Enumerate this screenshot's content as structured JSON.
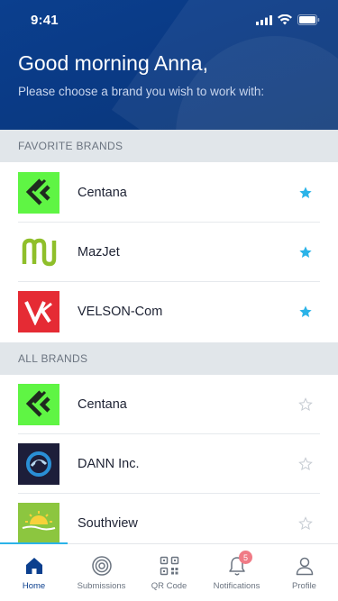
{
  "status_bar": {
    "time": "9:41"
  },
  "header": {
    "greeting": "Good morning Anna,",
    "subtitle": "Please choose a brand you wish to work with:"
  },
  "sections": {
    "favorites_title": "FAVORITE BRANDS",
    "all_title": "ALL BRANDS"
  },
  "favorite_brands": [
    {
      "name": "Centana",
      "logo": "centana-logo",
      "favorite": true
    },
    {
      "name": "MazJet",
      "logo": "mazjet-logo",
      "favorite": true
    },
    {
      "name": "VELSON-Com",
      "logo": "velson-logo",
      "favorite": true
    }
  ],
  "all_brands": [
    {
      "name": "Centana",
      "logo": "centana-logo",
      "favorite": false
    },
    {
      "name": "DANN Inc.",
      "logo": "dann-logo",
      "favorite": false
    },
    {
      "name": "Southview",
      "logo": "southview-logo",
      "favorite": false
    }
  ],
  "bottom_nav": {
    "items": [
      {
        "label": "Home",
        "icon": "home-icon",
        "active": true
      },
      {
        "label": "Submissions",
        "icon": "target-icon",
        "active": false
      },
      {
        "label": "QR Code",
        "icon": "qr-code-icon",
        "active": false
      },
      {
        "label": "Notifications",
        "icon": "bell-icon",
        "active": false,
        "badge": "5"
      },
      {
        "label": "Profile",
        "icon": "person-icon",
        "active": false
      }
    ]
  },
  "colors": {
    "header_bg": "#0b3f8e",
    "star_filled": "#2bb3e8",
    "star_outline": "#c5cbd2",
    "active_nav": "#0b3f8e",
    "badge": "#f07b86",
    "section_bg": "#e1e6ea"
  }
}
